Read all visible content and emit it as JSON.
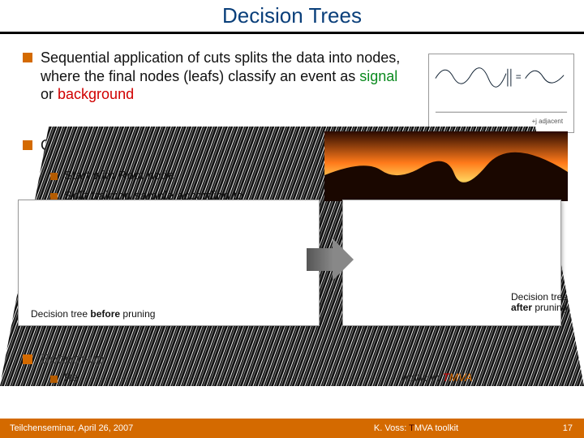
{
  "title": "Decision Trees",
  "intro": {
    "prefix": "Sequential application of cuts splits the data into nodes, where the final nodes (leafs) classify an event as ",
    "signal": "signal",
    "or": " or ",
    "background": "background"
  },
  "grow": {
    "heading": "Growing a decision tree:",
    "items": [
      "Start with Root node",
      "Split training sample according to"
    ]
  },
  "captions": {
    "left_pre": "Decision tree ",
    "left_bold": "before",
    "left_post": " pruning",
    "right_pre": "Decision tree ",
    "right_bold": "after",
    "right_post": " pruning"
  },
  "bottomup": {
    "heading": "Bottom-up",
    "sub_prefix": "Re",
    "sub_mid": " ",
    "sub_end": "matic in ",
    "tmva_t": "T",
    "tmva_rest": "MVA"
  },
  "footer": {
    "left": "Teilchenseminar, April 26, 2007",
    "center_pre": "K. Voss: ",
    "center_t": "T",
    "center_rest": "MVA toolkit",
    "page": "17"
  },
  "colors": {
    "accent": "#d46a00",
    "title": "#0a3f7a",
    "signal": "#0a8a1e",
    "background": "#d00000"
  }
}
